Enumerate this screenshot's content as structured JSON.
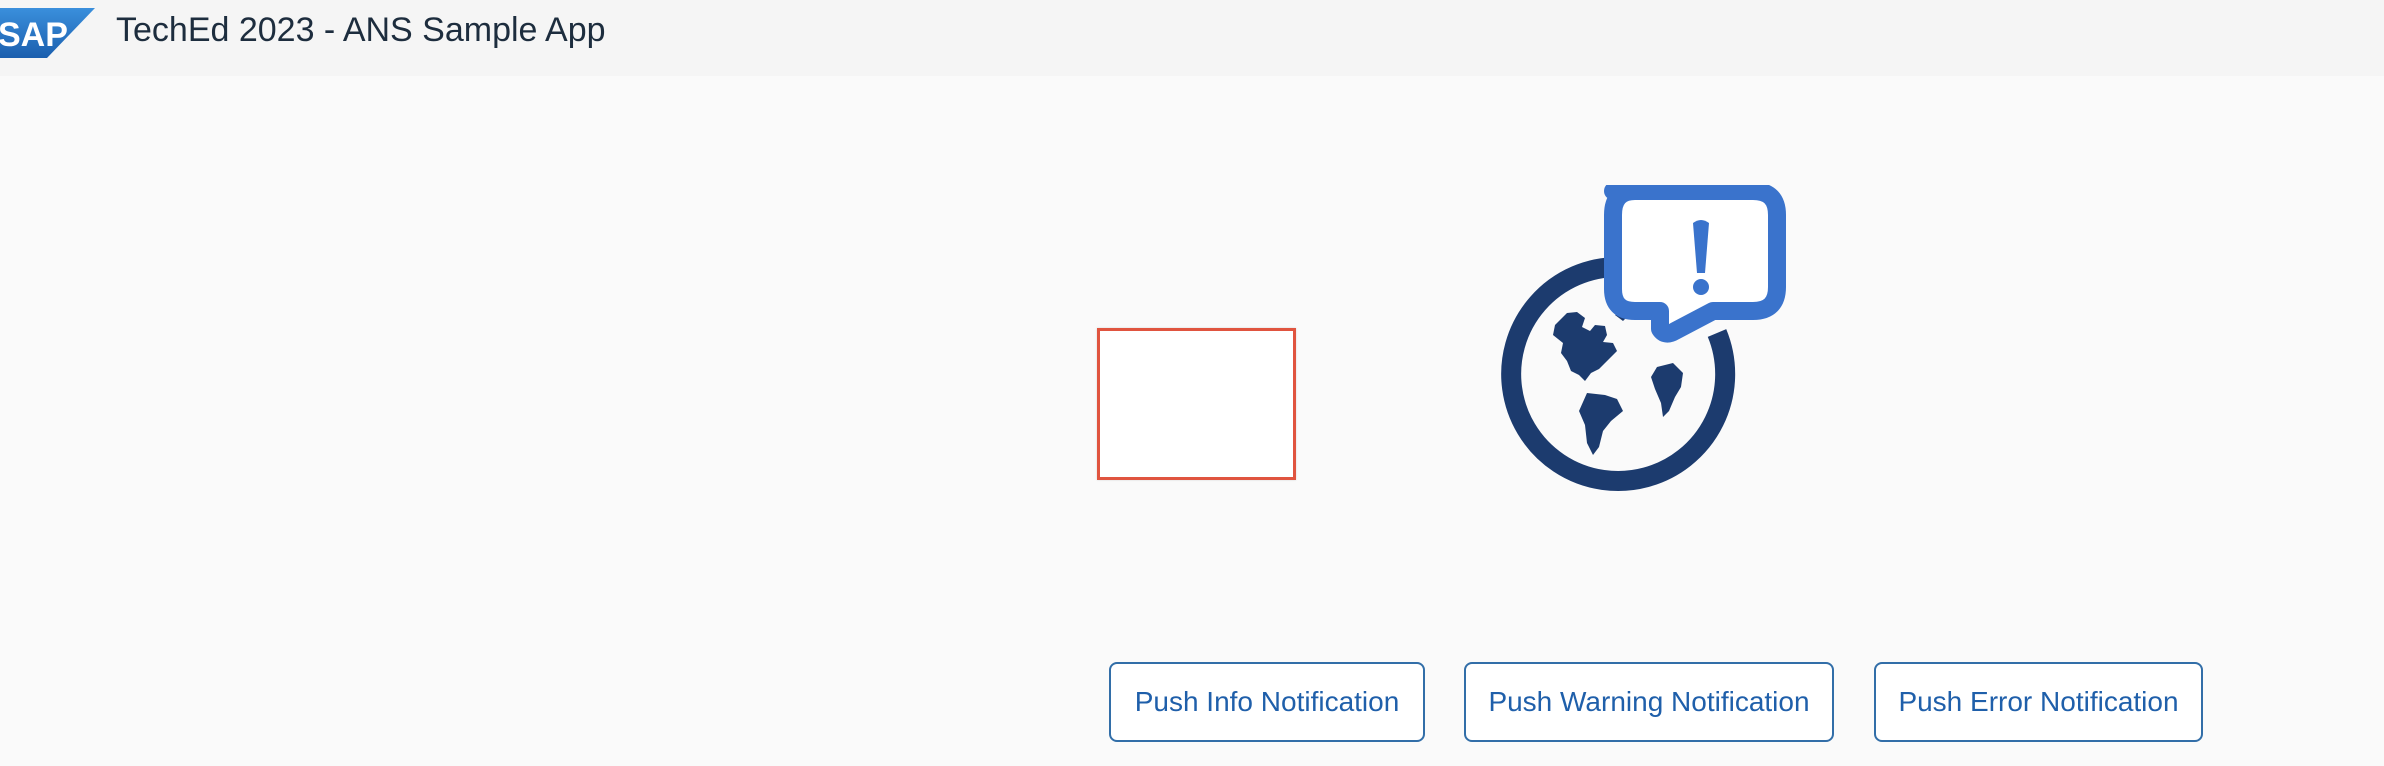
{
  "header": {
    "logo_text": "SAP",
    "title": "TechEd 2023 - ANS Sample App"
  },
  "illustration": {
    "icon": "globe-notification-icon",
    "colors": {
      "globe": "#1c3b6e",
      "bubble": "#3a73cc"
    }
  },
  "actions": {
    "info_label": "Push Info Notification",
    "warning_label": "Push Warning Notification",
    "error_label": "Push Error Notification"
  },
  "colors": {
    "accent": "#1f5faa",
    "frame_border": "#e0543f",
    "logo": "#2a78c8"
  }
}
